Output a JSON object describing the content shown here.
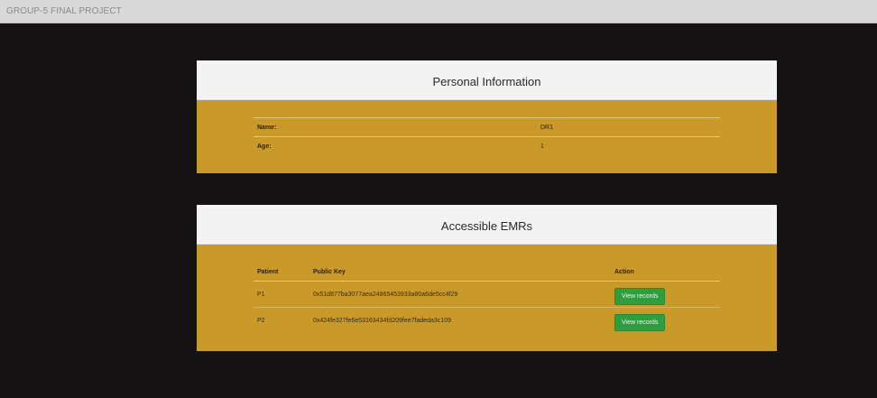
{
  "app": {
    "brand": "GROUP-5 FINAL PROJECT"
  },
  "personal": {
    "title": "Personal Information",
    "rows": [
      {
        "label": "Name:",
        "value": "DR1"
      },
      {
        "label": "Age:",
        "value": "1"
      }
    ]
  },
  "emr": {
    "title": "Accessible EMRs",
    "headers": {
      "patient": "Patient",
      "key": "Public Key",
      "action": "Action"
    },
    "rows": [
      {
        "patient": "P1",
        "key": "0x51d877ba3077aea24865453933a80a6de5cc4f29",
        "action": "View records"
      },
      {
        "patient": "P2",
        "key": "0x424fe327fe6e53163434fd209fee7fadeda3c109",
        "action": "View records"
      }
    ]
  },
  "colors": {
    "card_body": "#c99a2a",
    "card_header": "#f3f3f3",
    "button": "#2e9e3f",
    "background": "#141212",
    "topbar": "#d9d9d9"
  }
}
